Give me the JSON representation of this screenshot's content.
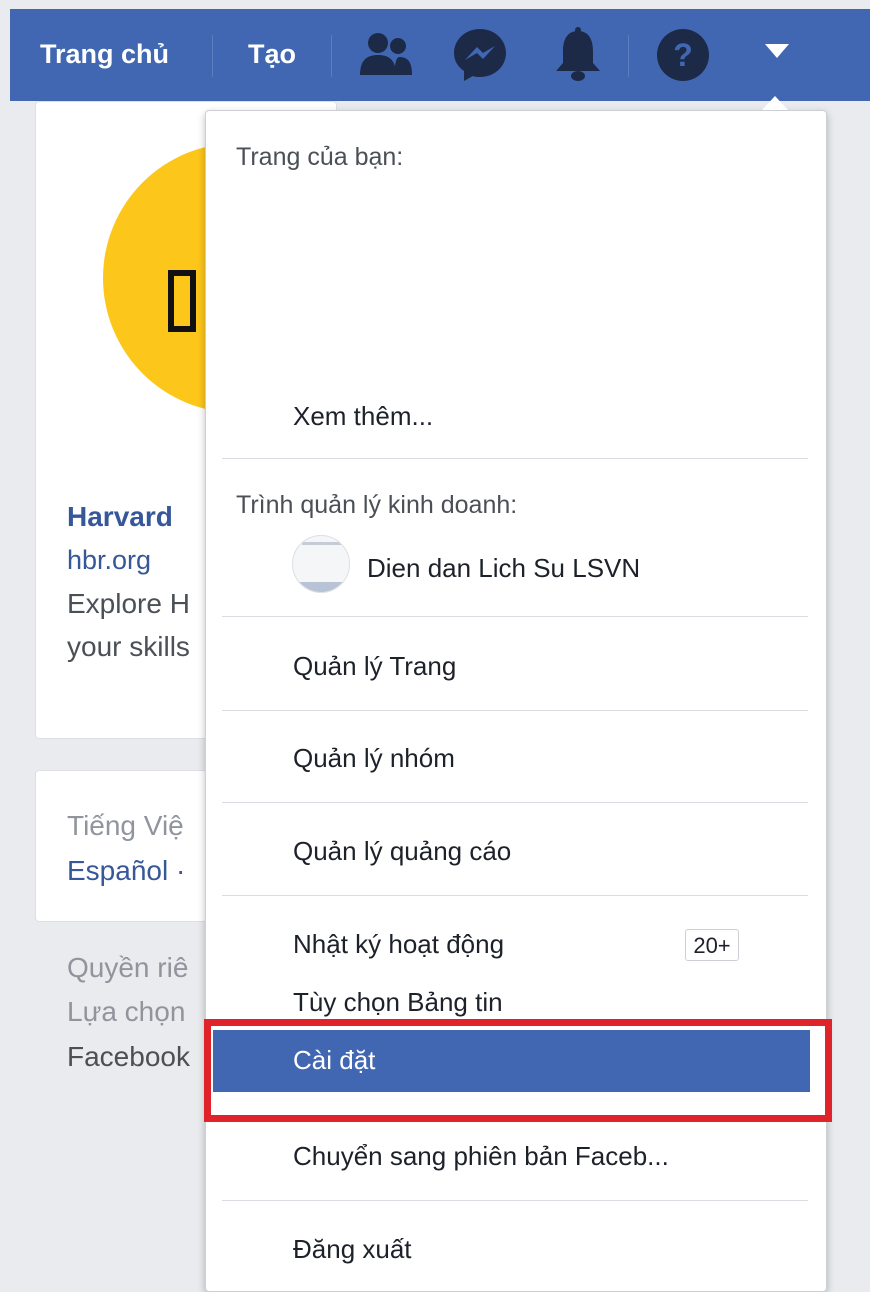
{
  "topbar": {
    "home_label": "Trang chủ",
    "create_label": "Tạo",
    "icons": [
      "friends-icon",
      "messenger-icon",
      "bell-icon",
      "help-icon",
      "dropdown-caret-icon"
    ],
    "bar_color": "#4267b2"
  },
  "background": {
    "ad": {
      "title": "Harvard",
      "url": "hbr.org",
      "line1": "Explore H",
      "line2": "your skills"
    },
    "languages": {
      "current": "Tiếng Việ",
      "other": "Español ·"
    },
    "footer": {
      "line1": "Quyền riê",
      "line2": "Lựa chọn",
      "line3": "Facebook"
    }
  },
  "menu": {
    "your_pages_header": "Trang của bạn:",
    "see_more": "Xem thêm...",
    "business_header": "Trình quản lý kinh doanh:",
    "business_page_name": "Dien dan Lich Su LSVN",
    "manage_pages": "Quản lý Trang",
    "manage_groups": "Quản lý nhóm",
    "manage_ads": "Quản lý quảng cáo",
    "activity_log": "Nhật ký hoạt động",
    "activity_badge": "20+",
    "news_feed_prefs": "Tùy chọn Bảng tin",
    "settings": "Cài đặt",
    "switch_version": "Chuyển sang phiên bản Faceb...",
    "logout": "Đăng xuất",
    "selected_color": "#4267b2",
    "highlight_color": "#e0232b"
  }
}
